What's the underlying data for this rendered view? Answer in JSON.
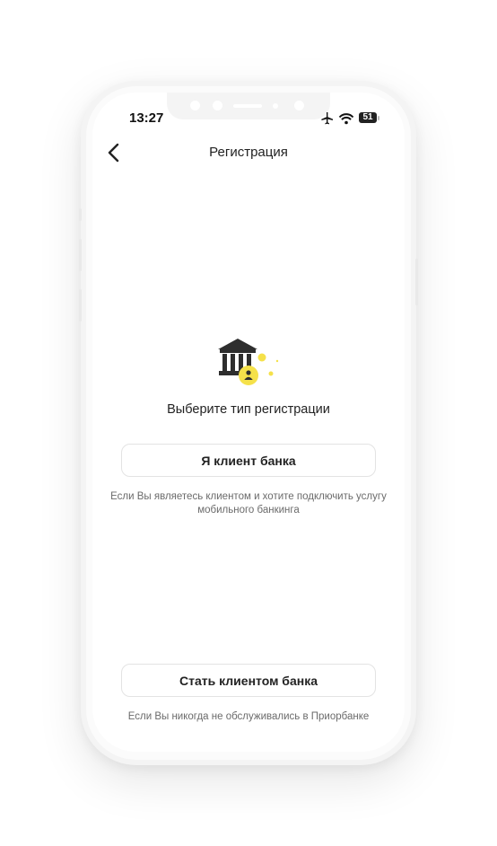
{
  "status_bar": {
    "time": "13:27",
    "battery": "51"
  },
  "header": {
    "title": "Регистрация",
    "back_icon": "chevron-left-icon"
  },
  "illustration": {
    "icon": "bank-user-icon",
    "accent_color": "#f5e14a"
  },
  "main": {
    "prompt": "Выберите тип регистрации",
    "client_button_label": "Я клиент банка",
    "client_hint": "Если Вы являетесь клиентом и хотите подключить услугу мобильного банкинга",
    "become_client_button_label": "Стать клиентом банка",
    "become_client_hint": "Если Вы никогда не обслуживались в Приорбанке"
  }
}
